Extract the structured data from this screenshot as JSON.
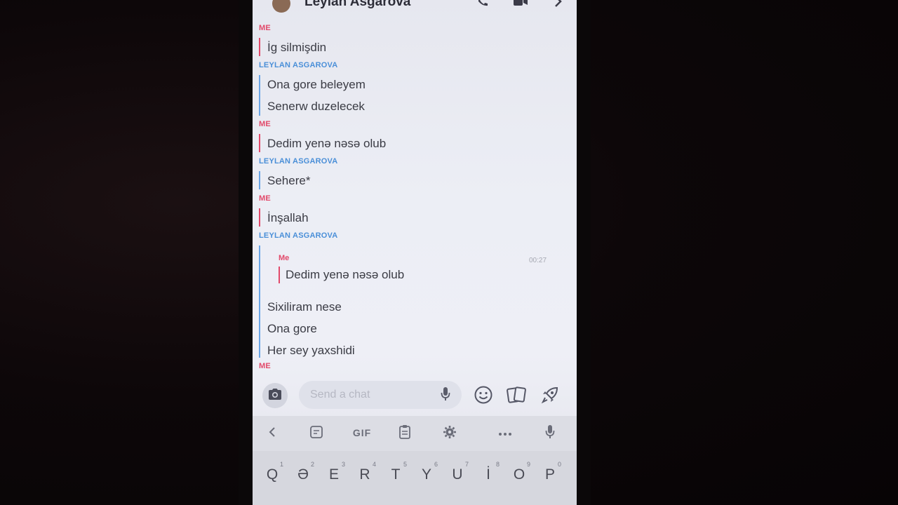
{
  "header": {
    "contact_name": "Leylan Asgarova"
  },
  "messages": [
    {
      "sender": "ME",
      "from": "me",
      "lines": [
        "İg silmişdin"
      ]
    },
    {
      "sender": "LEYLAN ASGAROVA",
      "from": "other",
      "lines": [
        "Ona gore beleyem",
        "Senerw duzelecek"
      ]
    },
    {
      "sender": "ME",
      "from": "me",
      "lines": [
        "Dedim yenə nəsə olub"
      ]
    },
    {
      "sender": "LEYLAN ASGAROVA",
      "from": "other",
      "lines": [
        "Sehere*"
      ]
    },
    {
      "sender": "ME",
      "from": "me",
      "lines": [
        "İnşallah"
      ]
    },
    {
      "sender": "LEYLAN ASGAROVA",
      "from": "other",
      "lines": [
        "Sixiliram nese",
        "Ona gore",
        "Her sey yaxshidi"
      ]
    },
    {
      "sender": "ME",
      "from": "me",
      "lines": []
    }
  ],
  "quote": {
    "sender": "Me",
    "text": "Dedim yenə nəsə olub",
    "time": "00:27"
  },
  "composer": {
    "placeholder": "Send a chat"
  },
  "keyboard": {
    "toolbar": {
      "gif_label": "GIF"
    },
    "keys": [
      {
        "label": "Q",
        "hint": "1"
      },
      {
        "label": "Ə",
        "hint": "2"
      },
      {
        "label": "E",
        "hint": "3"
      },
      {
        "label": "R",
        "hint": "4"
      },
      {
        "label": "T",
        "hint": "5"
      },
      {
        "label": "Y",
        "hint": "6"
      },
      {
        "label": "U",
        "hint": "7"
      },
      {
        "label": "İ",
        "hint": "8"
      },
      {
        "label": "O",
        "hint": "9"
      },
      {
        "label": "P",
        "hint": "0"
      }
    ]
  },
  "colors": {
    "me_accent": "#e2496a",
    "other_accent": "#4a8fd8"
  }
}
